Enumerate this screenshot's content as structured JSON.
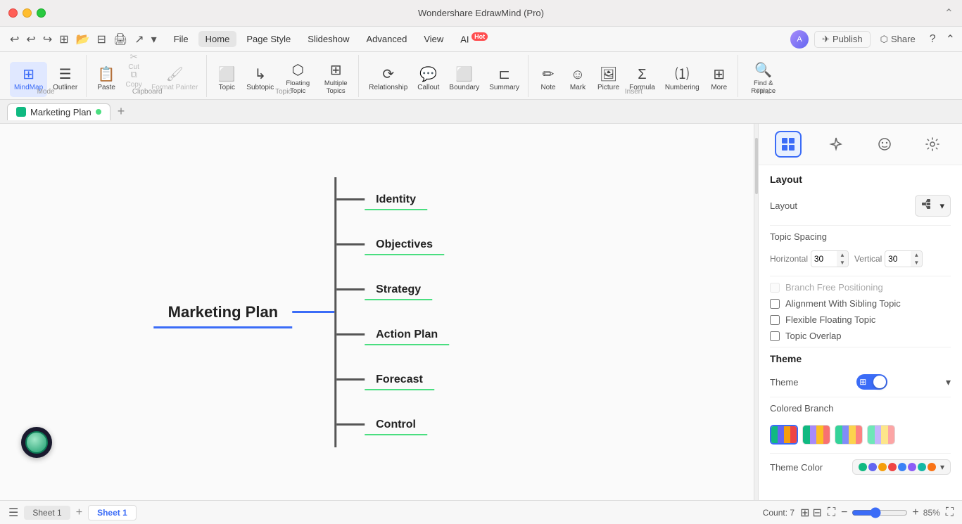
{
  "titlebar": {
    "title": "Wondershare EdrawMind (Pro)"
  },
  "menubar": {
    "items": [
      "File",
      "Home",
      "Page Style",
      "Slideshow",
      "Advanced",
      "View",
      "AI"
    ],
    "ai_hot": "Hot",
    "active": "Home",
    "publish_label": "Publish",
    "share_label": "Share",
    "help_label": "?"
  },
  "toolbar": {
    "mode_group_label": "Mode",
    "mindmap_label": "MindMap",
    "outliner_label": "Outliner",
    "clipboard_group_label": "Clipboard",
    "paste_label": "Paste",
    "cut_label": "Cut",
    "copy_label": "Copy",
    "format_painter_label": "Format Painter",
    "topic_group_label": "Topic",
    "topic_label": "Topic",
    "subtopic_label": "Subtopic",
    "floating_topic_label": "Floating Topic",
    "multiple_topics_label": "Multiple Topics",
    "relationship_label": "Relationship",
    "callout_label": "Callout",
    "boundary_label": "Boundary",
    "summary_label": "Summary",
    "insert_group_label": "Insert",
    "note_label": "Note",
    "mark_label": "Mark",
    "picture_label": "Picture",
    "formula_label": "Formula",
    "numbering_label": "Numbering",
    "more_label": "More",
    "find_group_label": "Find",
    "find_replace_label": "Find & Replace"
  },
  "tabs": {
    "items": [
      {
        "label": "Marketing Plan",
        "active": true,
        "dot_color": "#4ade80"
      }
    ]
  },
  "canvas": {
    "central_topic": "Marketing Plan",
    "subtopics": [
      "Identity",
      "Objectives",
      "Strategy",
      "Action Plan",
      "Forecast",
      "Control"
    ]
  },
  "right_panel": {
    "active_tab": "layout",
    "layout_section": {
      "title": "Layout",
      "layout_label": "Layout",
      "layout_icon": "⊞",
      "topic_spacing_label": "Topic Spacing",
      "horizontal_label": "Horizontal",
      "horizontal_value": "30",
      "vertical_label": "Vertical",
      "vertical_value": "30",
      "branch_free_positioning_label": "Branch Free Positioning",
      "branch_free_positioning_checked": false,
      "branch_free_positioning_disabled": true,
      "alignment_sibling_topic_label": "Alignment With Sibling Topic",
      "alignment_sibling_topic_checked": false,
      "flexible_floating_topic_label": "Flexible Floating Topic",
      "flexible_floating_topic_checked": false,
      "topic_overlap_label": "Topic Overlap",
      "topic_overlap_checked": false
    },
    "theme_section": {
      "title": "Theme",
      "theme_label": "Theme",
      "theme_enabled": true,
      "theme_select_label": "",
      "colored_branch_label": "Colored Branch",
      "colored_branch_options": [
        {
          "id": "option1",
          "selected": true,
          "colors": [
            "#10b981",
            "#6366f1",
            "#f59e0b",
            "#ef4444"
          ]
        },
        {
          "id": "option2",
          "selected": false,
          "colors": [
            "#10b981",
            "#a78bfa",
            "#fbbf24",
            "#f87171"
          ]
        },
        {
          "id": "option3",
          "selected": false,
          "colors": [
            "#34d399",
            "#818cf8",
            "#fcd34d",
            "#fc8181"
          ]
        },
        {
          "id": "option4",
          "selected": false,
          "colors": [
            "#6ee7b7",
            "#c4b5fd",
            "#fde68a",
            "#fca5a5"
          ]
        }
      ],
      "theme_color_label": "Theme Color",
      "theme_colors": [
        "#10b981",
        "#6366f1",
        "#f59e0b",
        "#ef4444",
        "#3b82f6",
        "#8b5cf6",
        "#14b8a6",
        "#f97316"
      ]
    }
  },
  "statusbar": {
    "sheet_label": "Sheet 1",
    "active_sheet": "Sheet 1",
    "count_label": "Count: 7",
    "zoom_level": "85%",
    "zoom_min": "10",
    "zoom_max": "200",
    "zoom_value": "85"
  }
}
